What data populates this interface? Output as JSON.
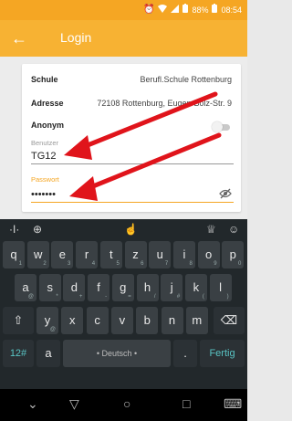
{
  "status_bar": {
    "battery_percent": "88%",
    "time": "08:54",
    "icons": [
      "alarm-icon",
      "wifi-icon",
      "signal-icon",
      "battery-icon"
    ]
  },
  "app_bar": {
    "title": "Login",
    "back_icon": "arrow-left-icon",
    "color": "#f7b233"
  },
  "form": {
    "school_label": "Schule",
    "school_value": "Berufl.Schule Rottenburg",
    "address_label": "Adresse",
    "address_value": "72108 Rottenburg, Eugen-Bolz-Str. 9",
    "anonym_label": "Anonym",
    "anonym_enabled": false,
    "user_label": "Benutzer",
    "user_value": "TG12",
    "password_label": "Passwort",
    "password_value": "•••••••",
    "password_toggle_icon": "eye-off-icon"
  },
  "keyboard": {
    "toolbar": [
      "text-cursor-icon",
      "globe-icon",
      "hand-icon",
      "theme-icon",
      "emoji-icon"
    ],
    "row1": [
      {
        "k": "q",
        "s": "1"
      },
      {
        "k": "w",
        "s": "2"
      },
      {
        "k": "e",
        "s": "3"
      },
      {
        "k": "r",
        "s": "4"
      },
      {
        "k": "t",
        "s": "5"
      },
      {
        "k": "z",
        "s": "6"
      },
      {
        "k": "u",
        "s": "7"
      },
      {
        "k": "i",
        "s": "8"
      },
      {
        "k": "o",
        "s": "9"
      },
      {
        "k": "p",
        "s": "0"
      }
    ],
    "row2": [
      {
        "k": "a",
        "s": "@"
      },
      {
        "k": "s",
        "s": "*"
      },
      {
        "k": "d",
        "s": "+"
      },
      {
        "k": "f",
        "s": "-"
      },
      {
        "k": "g",
        "s": "="
      },
      {
        "k": "h",
        "s": "/"
      },
      {
        "k": "j",
        "s": "#"
      },
      {
        "k": "k",
        "s": "("
      },
      {
        "k": "l",
        "s": ")"
      }
    ],
    "row3": [
      {
        "k": "y",
        "s": "@"
      },
      {
        "k": "x",
        "s": ""
      },
      {
        "k": "c",
        "s": ""
      },
      {
        "k": "v",
        "s": ""
      },
      {
        "k": "b",
        "s": ""
      },
      {
        "k": "n",
        "s": ""
      },
      {
        "k": "m",
        "s": ""
      }
    ],
    "symbols_key": "12#",
    "comma_key": "a",
    "space_label": "• Deutsch •",
    "period_key": ".",
    "done_key": "Fertig"
  },
  "nav_bar": {
    "buttons": [
      "back-nav-icon",
      "home-nav-icon",
      "recents-nav-icon",
      "keyboard-switch-icon"
    ]
  }
}
